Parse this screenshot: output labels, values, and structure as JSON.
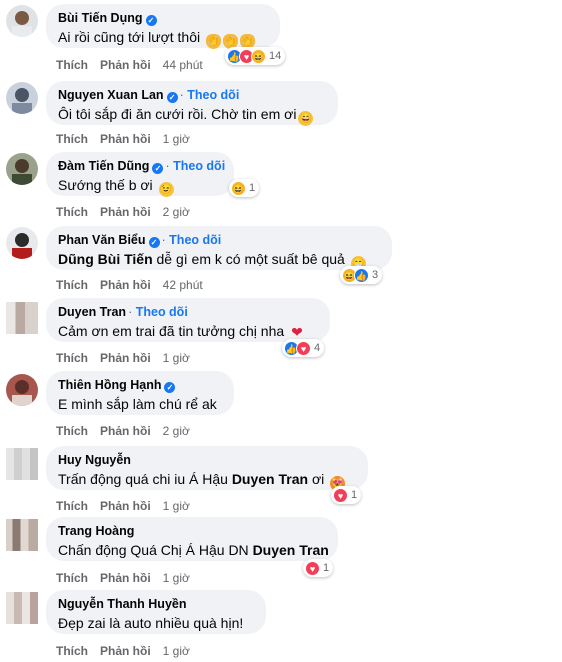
{
  "labels": {
    "like": "Thích",
    "reply": "Phản hồi",
    "follow": "Theo dõi"
  },
  "comments": [
    {
      "name": "Bùi Tiến Dụng",
      "text": "Ai rồi cũng tới lượt thôi",
      "time": "44 phút",
      "reactions": "14"
    },
    {
      "name": "Nguyen Xuan Lan",
      "text": "Ôi tôi sắp đi ăn cưới rồi. Chờ tin em ơi",
      "time": "1 giờ"
    },
    {
      "name": "Đàm Tiến Dũng",
      "text": "Sướng thế b ơi",
      "time": "2 giờ",
      "reactions": "1"
    },
    {
      "name": "Phan Văn Biểu",
      "mention": "Dũng Bùi Tiến",
      "text": " dễ gì em k có một suất bê quả",
      "time": "42 phút",
      "reactions": "3"
    },
    {
      "name": "Duyen Tran",
      "text": "Cảm ơn em trai đã tin tưởng chị nha",
      "time": "1 giờ",
      "reactions": "4"
    },
    {
      "name": "Thiên Hồng Hạnh",
      "text": "E mình sắp làm chú rể ak",
      "time": "2 giờ"
    },
    {
      "name": "Huy Nguyễn",
      "text": "Trấn động quá chi iu Á Hậu ",
      "mention": "Duyen Tran",
      "text2": " ơi",
      "time": "1 giờ",
      "reactions": "1"
    },
    {
      "name": "Trang Hoàng",
      "text": "Chấn động Quá Chị Á Hậu DN ",
      "mention": "Duyen Tran",
      "time": "1 giờ",
      "reactions": "1"
    },
    {
      "name": "Nguyễn Thanh Huyền",
      "text": "Đẹp zai là auto nhiều quà hịn!",
      "time": "1 giờ"
    }
  ]
}
